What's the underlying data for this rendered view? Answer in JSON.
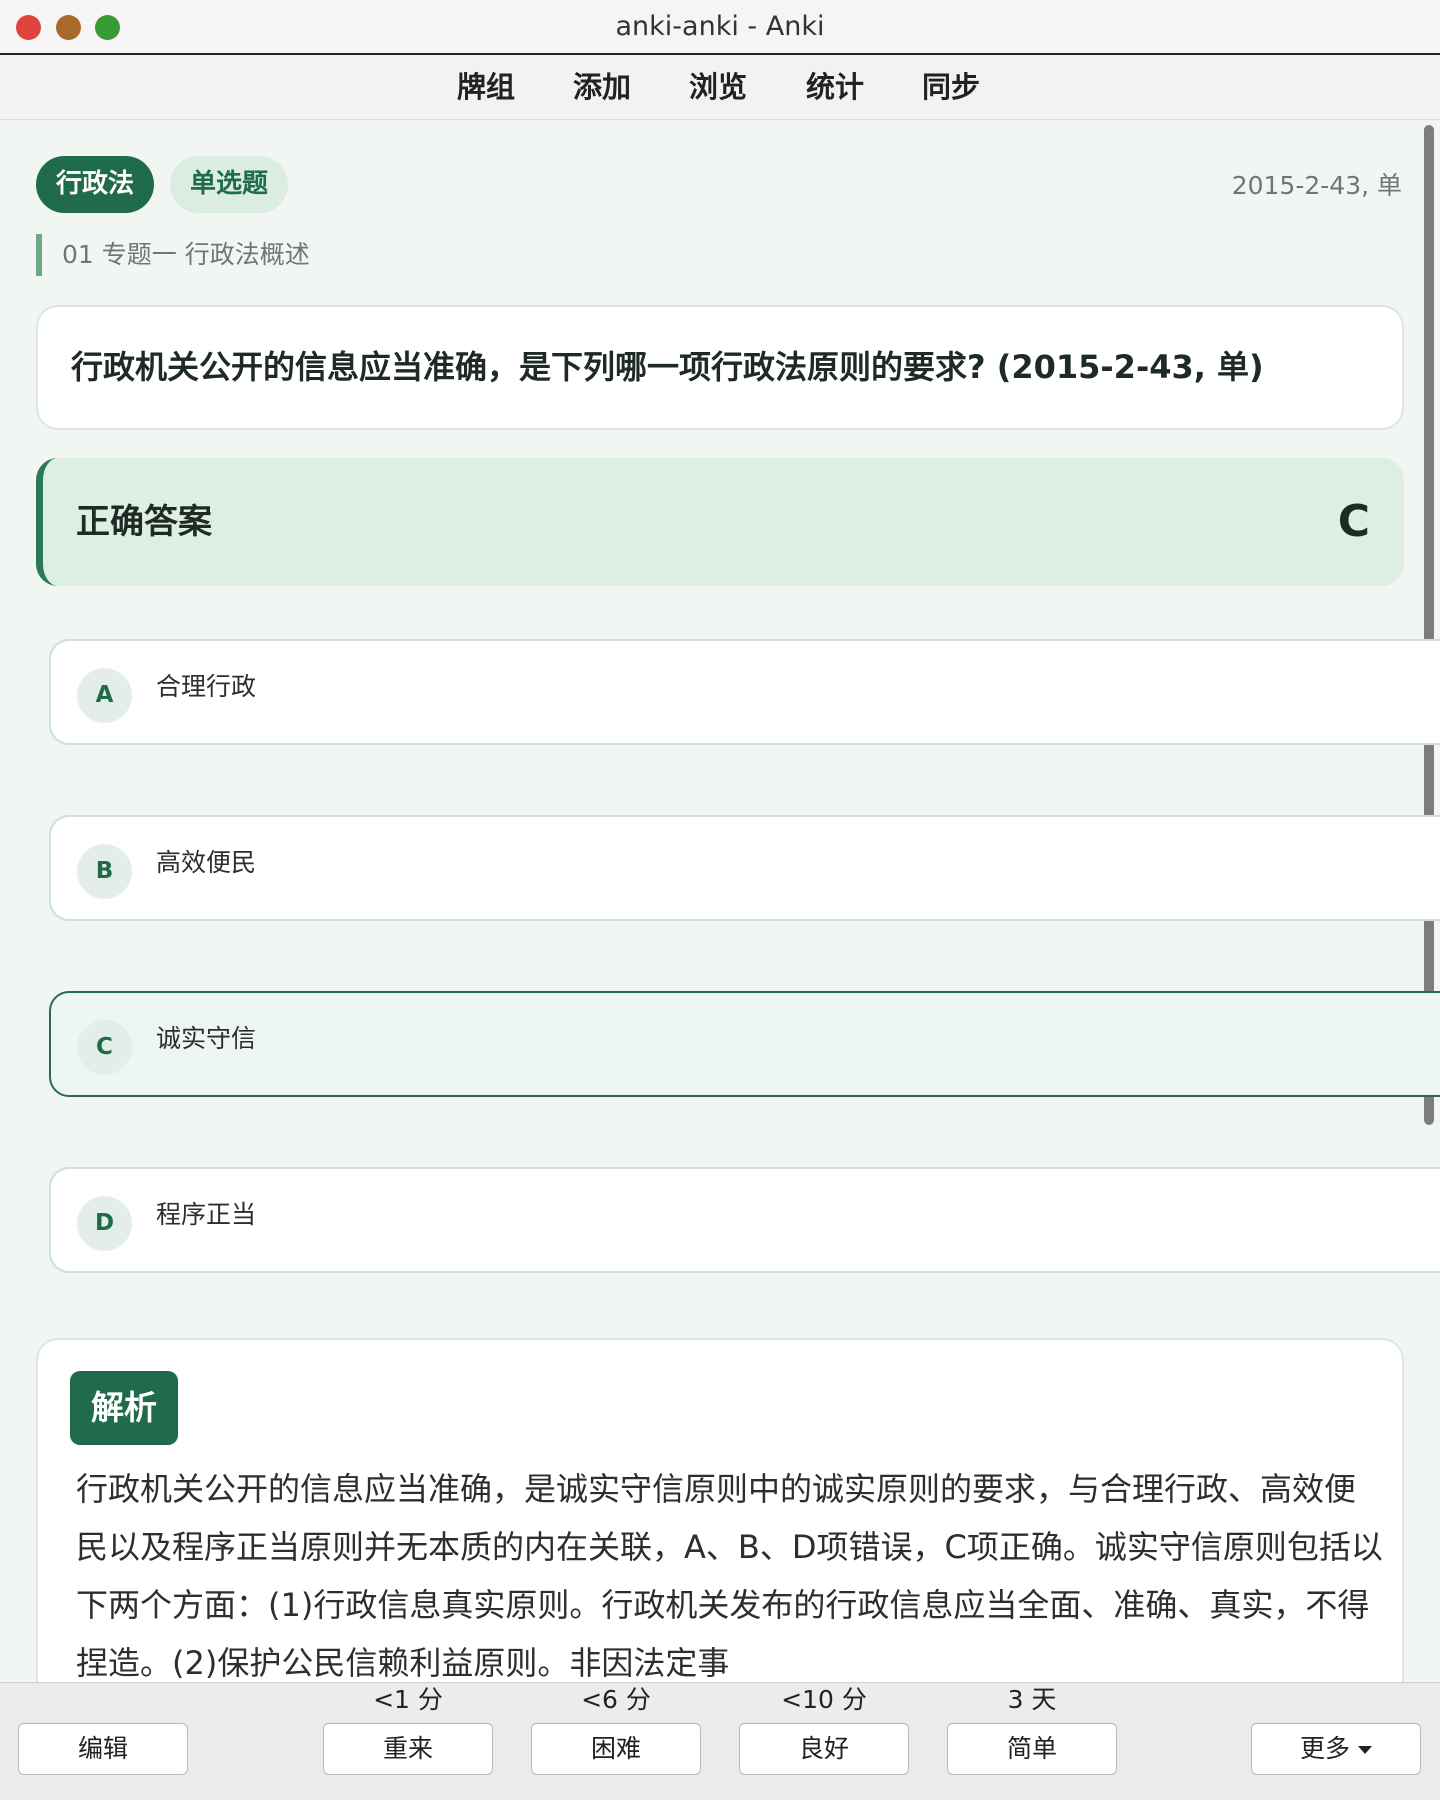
{
  "window": {
    "title": "anki-anki - Anki"
  },
  "toolbar": {
    "items": [
      "牌组",
      "添加",
      "浏览",
      "统计",
      "同步"
    ]
  },
  "card": {
    "tags": {
      "subject": "行政法",
      "type": "单选题"
    },
    "source": "2015-2-43, 单",
    "topic": "01 专题一 行政法概述",
    "question": "行政机关公开的信息应当准确，是下列哪一项行政法原则的要求? (2015-2-43, 单)",
    "answer": {
      "label": "正确答案",
      "letter": "C"
    },
    "options": [
      {
        "letter": "A",
        "text": "合理行政"
      },
      {
        "letter": "B",
        "text": "高效便民"
      },
      {
        "letter": "C",
        "text": "诚实守信"
      },
      {
        "letter": "D",
        "text": "程序正当"
      }
    ],
    "correct_option": "C",
    "explanation": {
      "label": "解析",
      "text": "行政机关公开的信息应当准确，是诚实守信原则中的诚实原则的要求，与合理行政、高效便民以及程序正当原则并无本质的内在关联，A、B、D项错误，C项正确。诚实守信原则包括以下两个方面：(1)行政信息真实原则。行政机关发布的行政信息应当全面、准确、真实，不得捏造。(2)保护公民信赖利益原则。非因法定事"
    }
  },
  "bottom": {
    "edit": "编辑",
    "more": "更多",
    "answers": [
      {
        "time": "<1 分",
        "label": "重来"
      },
      {
        "time": "<6 分",
        "label": "困难"
      },
      {
        "time": "<10 分",
        "label": "良好"
      },
      {
        "time": "3 天",
        "label": "简单"
      }
    ]
  },
  "colors": {
    "accent": "#1f6b4c",
    "background": "#f1f6f3",
    "answer_bg": "#ddeee4"
  }
}
